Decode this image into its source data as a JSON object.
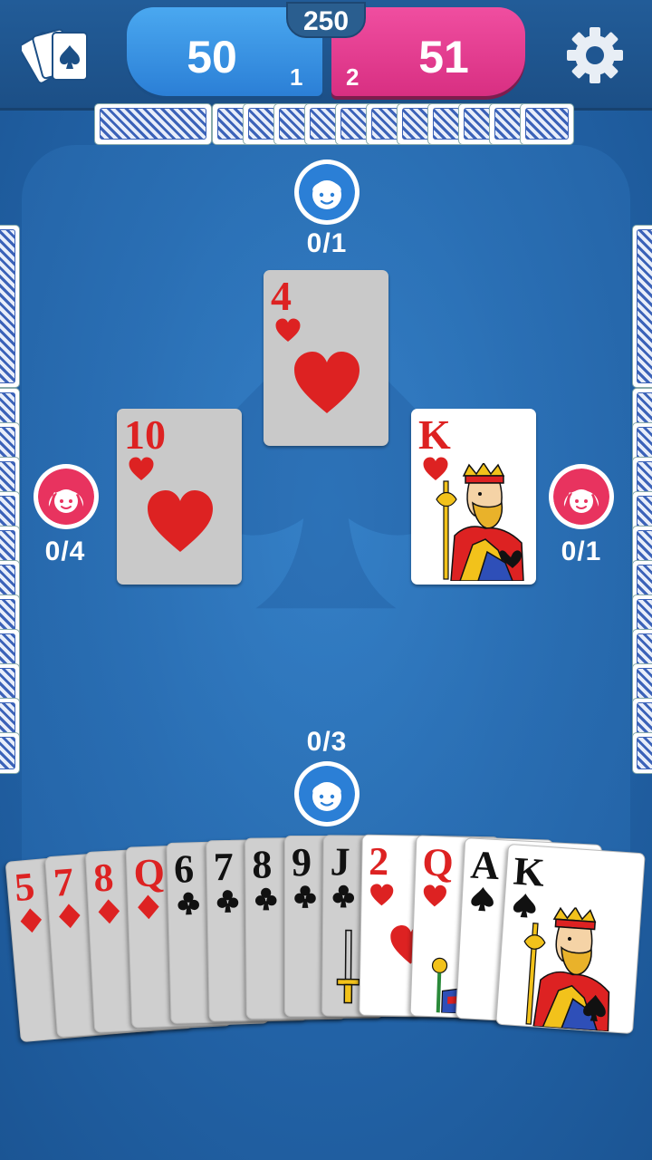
{
  "topbar": {
    "target_score": "250",
    "team1": {
      "score": "50",
      "rank": "1",
      "color": "#2b7fd6"
    },
    "team2": {
      "score": "51",
      "rank": "2",
      "color": "#d82f82"
    }
  },
  "icons": {
    "menu": "cards-menu-icon",
    "settings": "gear-icon",
    "partner": "boy-avatar-icon",
    "opponent": "girl-avatar-icon"
  },
  "players": {
    "north": {
      "bid": "0/1"
    },
    "west": {
      "bid": "0/4"
    },
    "east": {
      "bid": "0/1"
    },
    "south": {
      "bid": "0/3"
    }
  },
  "trick": [
    {
      "seat": "north",
      "rank": "4",
      "suit": "hearts"
    },
    {
      "seat": "west",
      "rank": "10",
      "suit": "hearts"
    },
    {
      "seat": "east",
      "rank": "K",
      "suit": "hearts"
    }
  ],
  "hand": [
    {
      "rank": "5",
      "suit": "diamonds"
    },
    {
      "rank": "7",
      "suit": "diamonds"
    },
    {
      "rank": "8",
      "suit": "diamonds"
    },
    {
      "rank": "Q",
      "suit": "diamonds"
    },
    {
      "rank": "6",
      "suit": "clubs"
    },
    {
      "rank": "7",
      "suit": "clubs"
    },
    {
      "rank": "8",
      "suit": "clubs"
    },
    {
      "rank": "9",
      "suit": "clubs"
    },
    {
      "rank": "J",
      "suit": "clubs"
    },
    {
      "rank": "2",
      "suit": "hearts"
    },
    {
      "rank": "Q",
      "suit": "hearts"
    },
    {
      "rank": "A",
      "suit": "spades"
    },
    {
      "rank": "K",
      "suit": "spades"
    }
  ],
  "colors": {
    "table": "#2466ab",
    "red_suit": "#dd2222",
    "black_suit": "#111111"
  }
}
